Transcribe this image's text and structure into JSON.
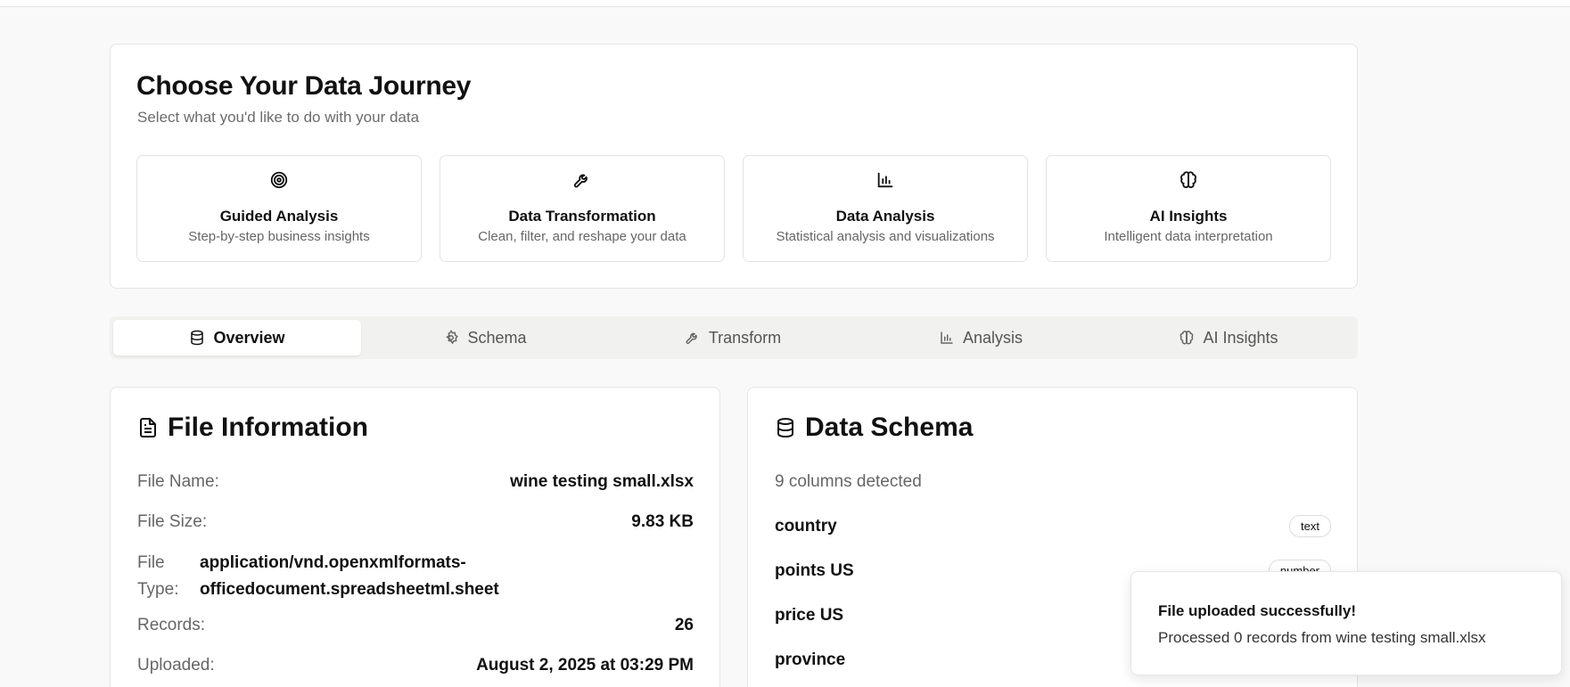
{
  "journey": {
    "title": "Choose Your Data Journey",
    "subtitle": "Select what you'd like to do with your data",
    "options": [
      {
        "icon": "target-icon",
        "title": "Guided Analysis",
        "desc": "Step-by-step business insights"
      },
      {
        "icon": "wrench-icon",
        "title": "Data Transformation",
        "desc": "Clean, filter, and reshape your data"
      },
      {
        "icon": "bar-chart-icon",
        "title": "Data Analysis",
        "desc": "Statistical analysis and visualizations"
      },
      {
        "icon": "brain-icon",
        "title": "AI Insights",
        "desc": "Intelligent data interpretation"
      }
    ]
  },
  "tabs": [
    {
      "icon": "database-icon",
      "label": "Overview",
      "active": true
    },
    {
      "icon": "gear-icon",
      "label": "Schema",
      "active": false
    },
    {
      "icon": "wrench-icon",
      "label": "Transform",
      "active": false
    },
    {
      "icon": "bar-chart-icon",
      "label": "Analysis",
      "active": false
    },
    {
      "icon": "brain-icon",
      "label": "AI Insights",
      "active": false
    }
  ],
  "file_info": {
    "title": "File Information",
    "file_name_label": "File Name:",
    "file_name": "wine testing small.xlsx",
    "file_size_label": "File Size:",
    "file_size": "9.83 KB",
    "file_type_label_1": "File",
    "file_type_label_2": "Type:",
    "file_type_line_1": "application/vnd.openxmlformats-",
    "file_type_line_2": "officedocument.spreadsheetml.sheet",
    "records_label": "Records:",
    "records": "26",
    "uploaded_label": "Uploaded:",
    "uploaded": "August 2, 2025 at 03:29 PM"
  },
  "schema": {
    "title": "Data Schema",
    "columns_detected": "9 columns detected",
    "columns": [
      {
        "name": "country",
        "type": "text"
      },
      {
        "name": "points US",
        "type": "number"
      },
      {
        "name": "price US",
        "type": ""
      },
      {
        "name": "province",
        "type": ""
      }
    ]
  },
  "toast": {
    "title": "File uploaded successfully!",
    "message": "Processed 0 records from wine testing small.xlsx"
  },
  "colors": {
    "background": "#f9f9f9",
    "card": "#ffffff",
    "tabs_bg": "#f1f1ef",
    "text": "#111111",
    "muted": "#666666"
  }
}
